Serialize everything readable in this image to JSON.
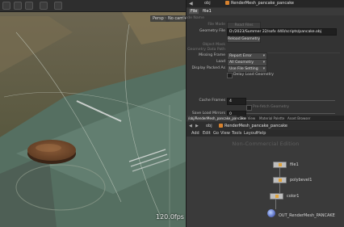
{
  "viewport": {
    "fps_label": "120.0fps",
    "chips": [
      "Persp ▾",
      "No cam ▾"
    ]
  },
  "topbar": {
    "back": "◀",
    "path": "obj",
    "node": "RenderMesh_pancake_pancake"
  },
  "param_header": {
    "type": "File",
    "name": "file1"
  },
  "params": {
    "node_name": "Node Name",
    "file_mode_label": "File Mode",
    "file_mode_value": "Read Files",
    "geometry_file_label": "Geometry File",
    "geometry_file_value": "D:/2023/Summer 22/sofx 440/scripts/pancake.obj",
    "reload_geometry": "Reload Geometry",
    "object_mask": "Object Mask",
    "geometry_data_path": "Geometry Data Path",
    "missing_frame_label": "Missing Frame",
    "missing_frame_value": "Report Error",
    "load_label": "Load",
    "load_value": "All Geometry",
    "display_packed_label": "Display Packed As",
    "display_packed_value": "Use File Setting",
    "delay_load_geometry": "Delay Load Geometry",
    "cache_frames_label": "Cache Frames",
    "cache_frames_value": "4",
    "prefetch_geometry": "Pre-fetch Geometry",
    "save_load_label": "Save Load Mirrors",
    "save_load_value": "0"
  },
  "tabs": [
    "/obj/RenderMesh_pancake_pancake",
    "Tree View",
    "Material Palette",
    "Asset Browser"
  ],
  "network_path": {
    "back": "◀",
    "forward": "▶",
    "obj": "obj",
    "node": "RenderMesh_pancake_pancake"
  },
  "menu": [
    "Add",
    "Edit",
    "Go",
    "View",
    "Tools",
    "Layout",
    "Help"
  ],
  "network": {
    "title": "Non-Commercial Edition",
    "nodes": [
      {
        "name": "file1"
      },
      {
        "name": "polybevel1"
      },
      {
        "name": "color1"
      }
    ],
    "output_node": "OUT_RenderMesh_PANCAKE"
  }
}
